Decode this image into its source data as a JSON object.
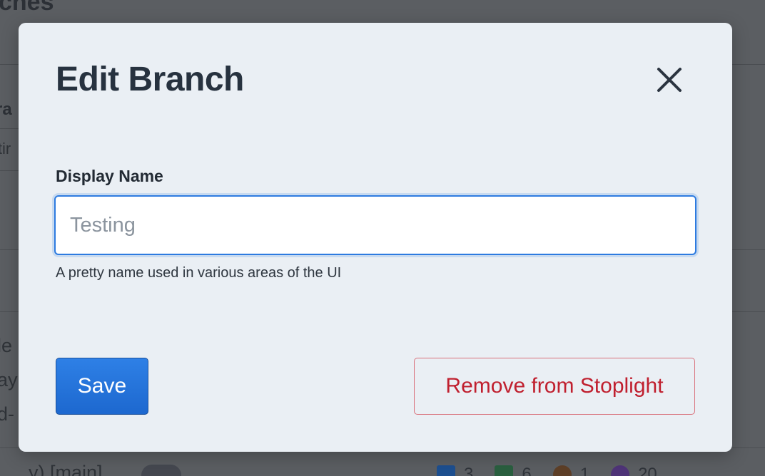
{
  "background": {
    "page_title": "ches",
    "tab_fragment": "ra",
    "input_fragment": "itir",
    "list_fragments": [
      "le",
      "ay",
      "d-"
    ],
    "row_label": "y) [main]",
    "stats": [
      {
        "icon": "book-icon",
        "value": "3",
        "color": "#1d5fb4"
      },
      {
        "icon": "cube-icon",
        "value": "6",
        "color": "#2f7a4a"
      },
      {
        "icon": "paw-icon",
        "value": "1",
        "color": "#7a4a25"
      },
      {
        "icon": "target-icon",
        "value": "20",
        "color": "#6a3aa8"
      }
    ]
  },
  "modal": {
    "title": "Edit Branch",
    "display_name": {
      "label": "Display Name",
      "value": "",
      "placeholder": "Testing",
      "help": "A pretty name used in various areas of the UI"
    },
    "save_label": "Save",
    "remove_label": "Remove from Stoplight"
  },
  "colors": {
    "primary": "#1d68cf",
    "danger": "#c0202f",
    "modal_bg": "#eaeff4",
    "overlay": "#5b5e62"
  }
}
